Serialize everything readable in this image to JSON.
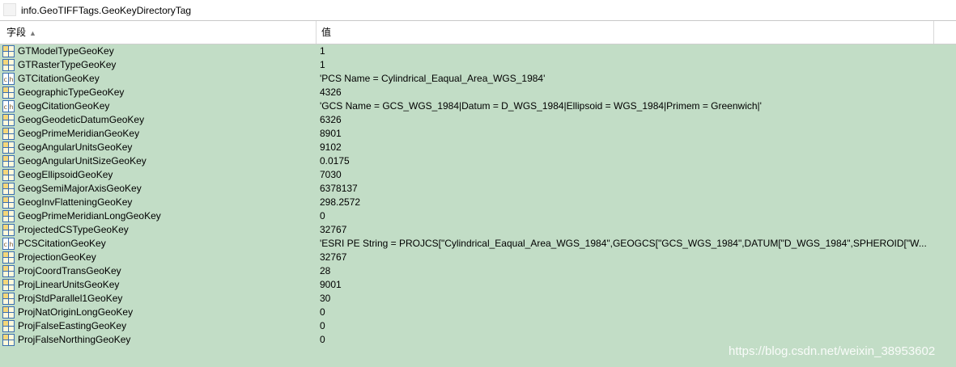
{
  "window": {
    "title": "info.GeoTIFFTags.GeoKeyDirectoryTag"
  },
  "header": {
    "field": "字段",
    "value": "值"
  },
  "colors": {
    "row_bg": "#c2ddc6",
    "grid_icon": "#3b6fb0",
    "text_icon": "#7a5a2e"
  },
  "rows": [
    {
      "name": "GTModelTypeGeoKey",
      "value": "1",
      "icon": "grid-icon"
    },
    {
      "name": "GTRasterTypeGeoKey",
      "value": "1",
      "icon": "grid-icon"
    },
    {
      "name": "GTCitationGeoKey",
      "value": "'PCS Name = Cylindrical_Eaqual_Area_WGS_1984'",
      "icon": "text-icon"
    },
    {
      "name": "GeographicTypeGeoKey",
      "value": "4326",
      "icon": "grid-icon"
    },
    {
      "name": "GeogCitationGeoKey",
      "value": "'GCS Name = GCS_WGS_1984|Datum = D_WGS_1984|Ellipsoid = WGS_1984|Primem = Greenwich|'",
      "icon": "text-icon"
    },
    {
      "name": "GeogGeodeticDatumGeoKey",
      "value": "6326",
      "icon": "grid-icon"
    },
    {
      "name": "GeogPrimeMeridianGeoKey",
      "value": "8901",
      "icon": "grid-icon"
    },
    {
      "name": "GeogAngularUnitsGeoKey",
      "value": "9102",
      "icon": "grid-icon"
    },
    {
      "name": "GeogAngularUnitSizeGeoKey",
      "value": "0.0175",
      "icon": "grid-icon"
    },
    {
      "name": "GeogEllipsoidGeoKey",
      "value": "7030",
      "icon": "grid-icon"
    },
    {
      "name": "GeogSemiMajorAxisGeoKey",
      "value": "6378137",
      "icon": "grid-icon"
    },
    {
      "name": "GeogInvFlatteningGeoKey",
      "value": "298.2572",
      "icon": "grid-icon"
    },
    {
      "name": "GeogPrimeMeridianLongGeoKey",
      "value": "0",
      "icon": "grid-icon"
    },
    {
      "name": "ProjectedCSTypeGeoKey",
      "value": "32767",
      "icon": "grid-icon"
    },
    {
      "name": "PCSCitationGeoKey",
      "value": "'ESRI PE String = PROJCS[\"Cylindrical_Eaqual_Area_WGS_1984\",GEOGCS[\"GCS_WGS_1984\",DATUM[\"D_WGS_1984\",SPHEROID[\"W...",
      "icon": "text-icon"
    },
    {
      "name": "ProjectionGeoKey",
      "value": "32767",
      "icon": "grid-icon"
    },
    {
      "name": "ProjCoordTransGeoKey",
      "value": "28",
      "icon": "grid-icon"
    },
    {
      "name": "ProjLinearUnitsGeoKey",
      "value": "9001",
      "icon": "grid-icon"
    },
    {
      "name": "ProjStdParallel1GeoKey",
      "value": "30",
      "icon": "grid-icon"
    },
    {
      "name": "ProjNatOriginLongGeoKey",
      "value": "0",
      "icon": "grid-icon"
    },
    {
      "name": "ProjFalseEastingGeoKey",
      "value": "0",
      "icon": "grid-icon"
    },
    {
      "name": "ProjFalseNorthingGeoKey",
      "value": "0",
      "icon": "grid-icon"
    }
  ],
  "watermark": "https://blog.csdn.net/weixin_38953602"
}
